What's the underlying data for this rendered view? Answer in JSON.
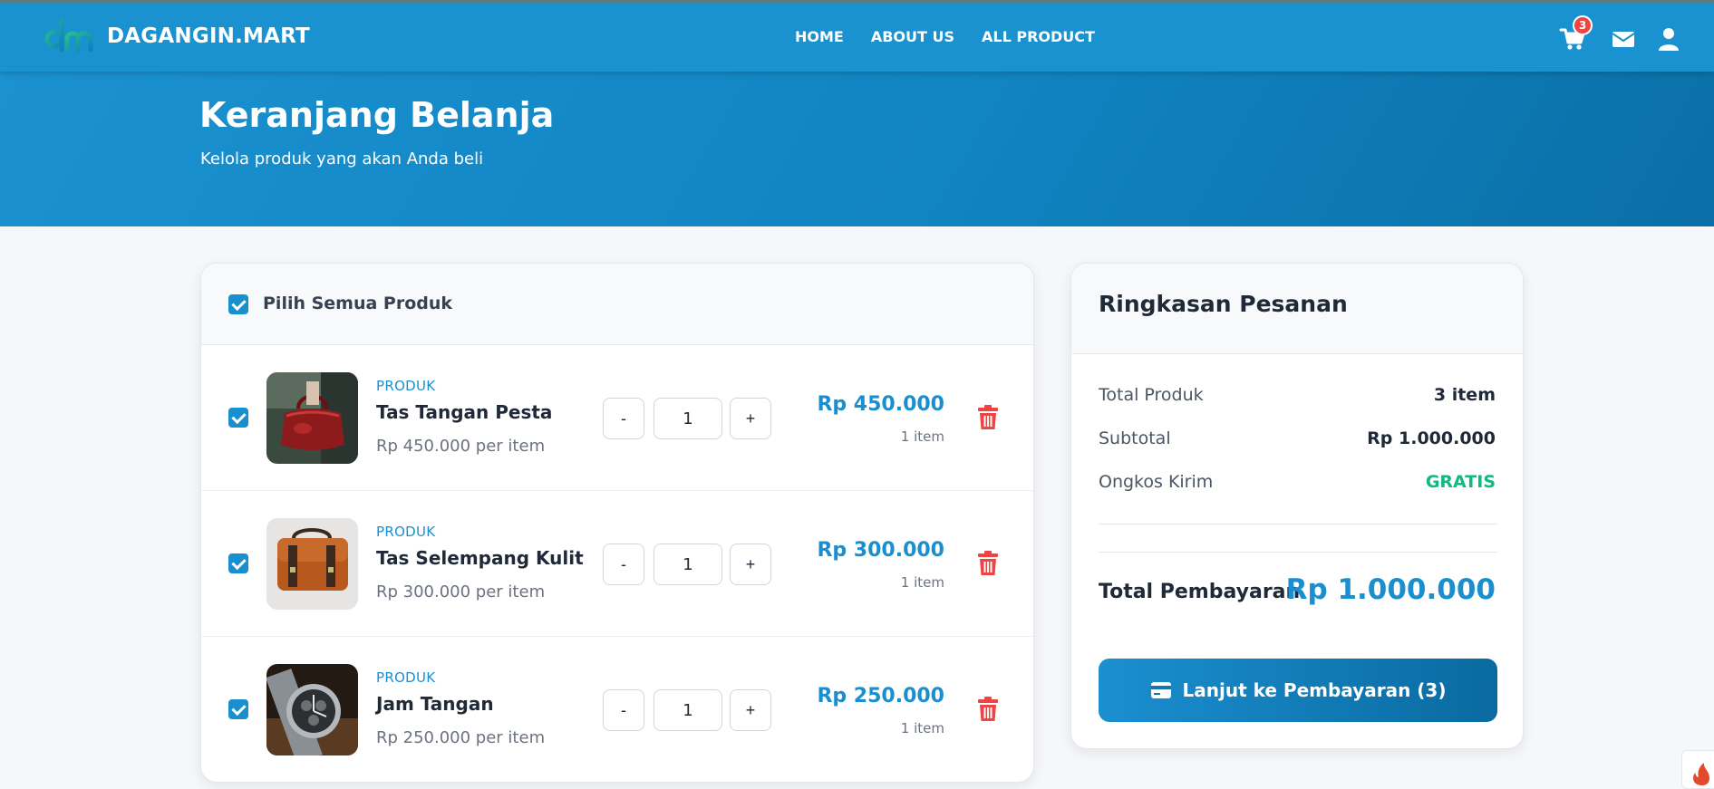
{
  "brand": {
    "name": "DAGANGIN.MART",
    "logo_icon": "dm-logo-icon"
  },
  "nav": {
    "links": [
      "HOME",
      "ABOUT US",
      "ALL PRODUCT"
    ],
    "cart_count": "3",
    "icons": [
      "cart-icon",
      "mail-icon",
      "user-icon"
    ]
  },
  "hero": {
    "title": "Keranjang Belanja",
    "subtitle": "Kelola produk yang akan Anda beli"
  },
  "cart": {
    "select_all_label": "Pilih Semua Produk",
    "select_all_checked": true,
    "items": [
      {
        "category": "PRODUK",
        "name": "Tas Tangan Pesta",
        "unit_price": "Rp 450.000 per item",
        "qty": "1",
        "price": "Rp 450.000",
        "qty_text": "1 item",
        "checked": true,
        "minus": "-",
        "plus": "+"
      },
      {
        "category": "PRODUK",
        "name": "Tas Selempang Kulit",
        "unit_price": "Rp 300.000 per item",
        "qty": "1",
        "price": "Rp 300.000",
        "qty_text": "1 item",
        "checked": true,
        "minus": "-",
        "plus": "+"
      },
      {
        "category": "PRODUK",
        "name": "Jam Tangan",
        "unit_price": "Rp 250.000 per item",
        "qty": "1",
        "price": "Rp 250.000",
        "qty_text": "1 item",
        "checked": true,
        "minus": "-",
        "plus": "+"
      }
    ]
  },
  "summary": {
    "title": "Ringkasan Pesanan",
    "rows": [
      {
        "label": "Total Produk",
        "value": "3 item"
      },
      {
        "label": "Subtotal",
        "value": "Rp 1.000.000"
      },
      {
        "label": "Ongkos Kirim",
        "value": "GRATIS"
      }
    ],
    "total_label": "Total Pembayaran",
    "total_value": "Rp 1.000.000",
    "checkout_label": "Lanjut ke Pembayaran (3)"
  },
  "colors": {
    "primary": "#1a92cf",
    "accent_price": "#1a8fd0",
    "free_shipping": "#10b981",
    "danger": "#ef4444"
  }
}
